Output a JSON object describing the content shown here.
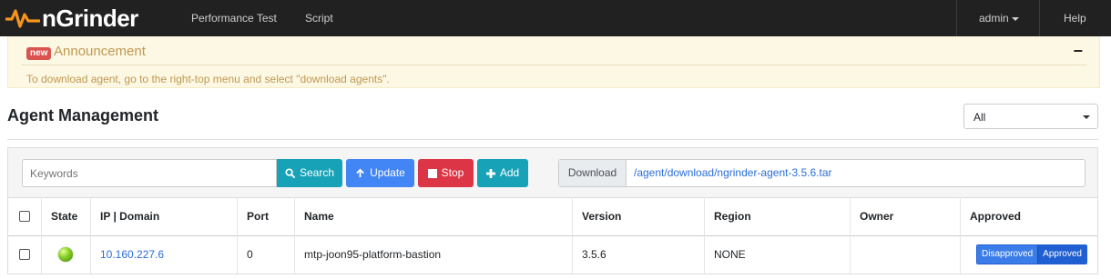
{
  "app": {
    "name": "nGrinder"
  },
  "nav": {
    "items": [
      {
        "label": "Performance Test"
      },
      {
        "label": "Script"
      }
    ],
    "user": "admin",
    "help": "Help"
  },
  "announcement": {
    "badge": "new",
    "title": "Announcement",
    "collapse": "−",
    "message": "To download agent, go to the right-top menu and select \"download agents\"."
  },
  "page": {
    "title": "Agent Management",
    "region_filter": {
      "selected": "All"
    }
  },
  "toolbar": {
    "keywords_placeholder": "Keywords",
    "search_label": "Search",
    "update_label": "Update",
    "stop_label": "Stop",
    "add_label": "Add",
    "download_label": "Download",
    "download_link": "/agent/download/ngrinder-agent-3.5.6.tar"
  },
  "table": {
    "columns": [
      "State",
      "IP | Domain",
      "Port",
      "Name",
      "Version",
      "Region",
      "Owner",
      "Approved"
    ],
    "rows": [
      {
        "state": "running",
        "ip": "10.160.227.6",
        "port": "0",
        "name": "mtp-joon95-platform-bastion",
        "version": "3.5.6",
        "region": "NONE",
        "owner": "",
        "approval": {
          "disapproved_label": "Disapproved",
          "approved_label": "Approved",
          "value": "Approved"
        }
      }
    ]
  },
  "colors": {
    "topbar": "#212121",
    "announcement_bg": "#fcf8e3",
    "search": "#17a2b8",
    "update": "#4285f4",
    "stop": "#dc3545",
    "add": "#17a2b8",
    "link": "#2a6ed8"
  },
  "icons": {
    "logo": "pulse-logo-icon",
    "search": "search-icon",
    "update": "arrow-up-icon",
    "stop": "stop-square-icon",
    "add": "plus-icon",
    "state": "green-status-icon"
  }
}
